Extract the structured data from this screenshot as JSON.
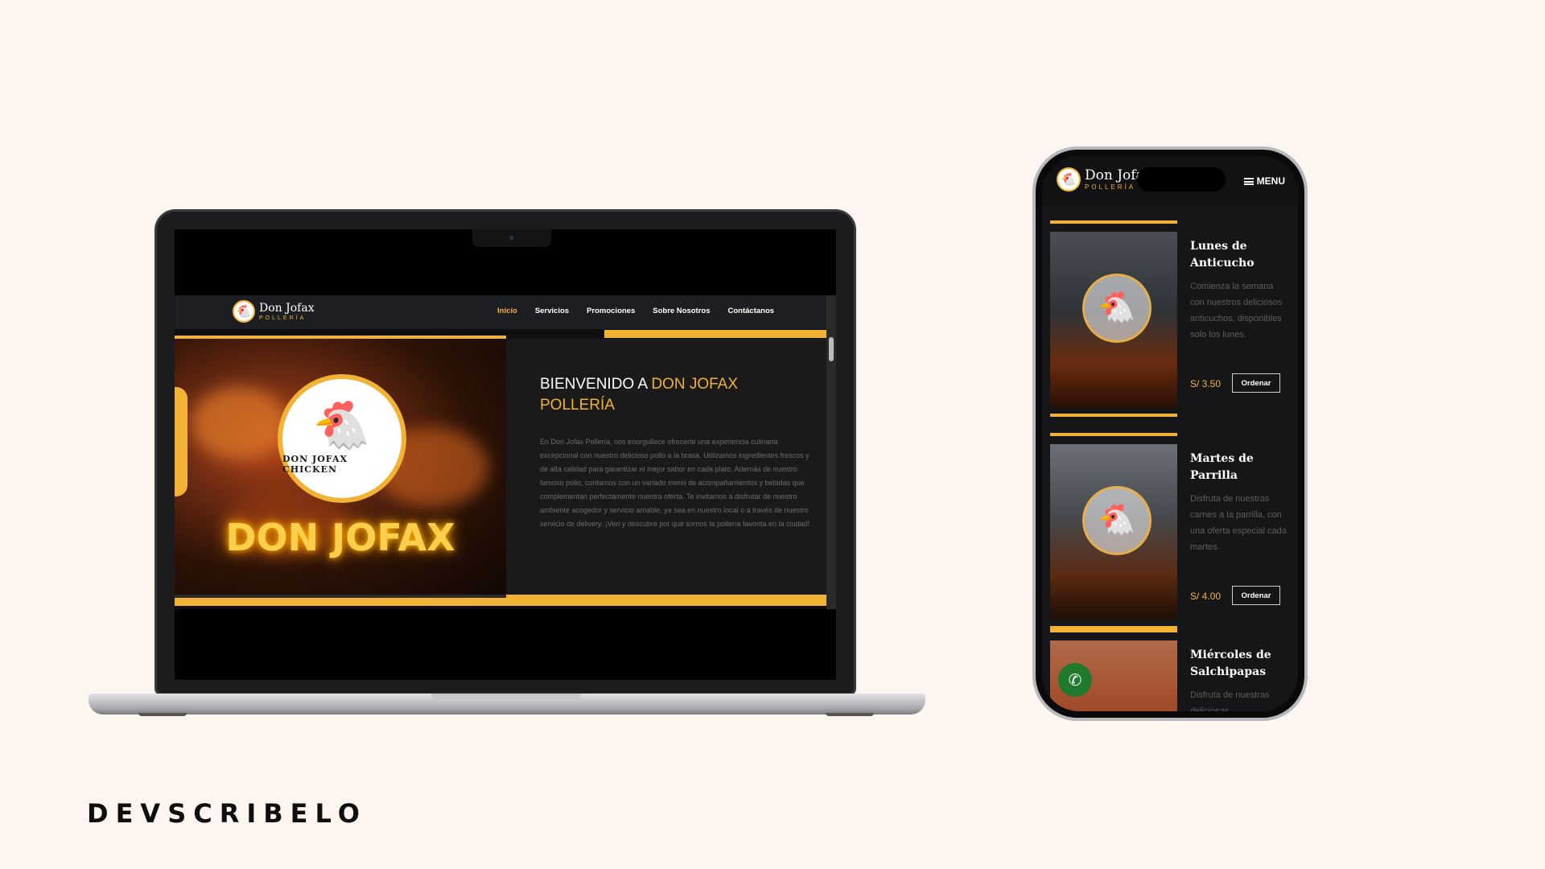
{
  "brand": "DEVSCRIBELO",
  "site": {
    "logo": {
      "name": "Don Jofax",
      "sub": "POLLERÍA",
      "icon": "chicken-mascot-icon"
    },
    "nav": [
      {
        "label": "Inicio",
        "active": true
      },
      {
        "label": "Servicios",
        "active": false
      },
      {
        "label": "Promociones",
        "active": false
      },
      {
        "label": "Sobre Nosotros",
        "active": false
      },
      {
        "label": "Contáctanos",
        "active": false
      }
    ],
    "hero": {
      "emblem_text": "DON JOFAX CHICKEN",
      "neon_text": "DON JOFAX",
      "title_white": "BIENVENIDO A ",
      "title_gold": "DON JOFAX POLLERÍA",
      "paragraph": "En Don Jofax Pollería, nos enorgullece ofrecerte una experiencia culinaria excepcional con nuestro delicioso pollo a la brasa. Utilizamos ingredientes frescos y de alta calidad para garantizar el mejor sabor en cada plato. Además de nuestro famoso pollo, contamos con un variado menú de acompañamientos y bebidas que complementan perfectamente nuestra oferta. Te invitamos a disfrutar de nuestro ambiente acogedor y servicio amable, ya sea en nuestro local o a través de nuestro servicio de delivery. ¡Ven y descubre por qué somos la pollería favorita en la ciudad!"
    },
    "whatsapp_icon": "whatsapp-icon"
  },
  "mobile": {
    "logo": {
      "name": "Don Jofax",
      "sub": "POLLERÍA"
    },
    "menu_label": "MENU",
    "promos": [
      {
        "title": "Lunes de Anticucho",
        "desc": "Comienza la semana con nuestros deliciosos anticuchos, disponibles solo los lunes.",
        "price": "S/ 3.50",
        "button": "Ordenar"
      },
      {
        "title": "Martes de Parrilla",
        "desc": "Disfruta de nuestras carnes a la parrilla, con una oferta especial cada martes.",
        "price": "S/ 4.00",
        "button": "Ordenar"
      },
      {
        "title": "Miércoles de Salchipapas",
        "desc": "Disfruta de nuestras deliciosas",
        "price": "",
        "button": ""
      }
    ]
  },
  "colors": {
    "accent": "#f2b233",
    "background": "#fdf6f0",
    "whatsapp": "#1f7a2e"
  }
}
